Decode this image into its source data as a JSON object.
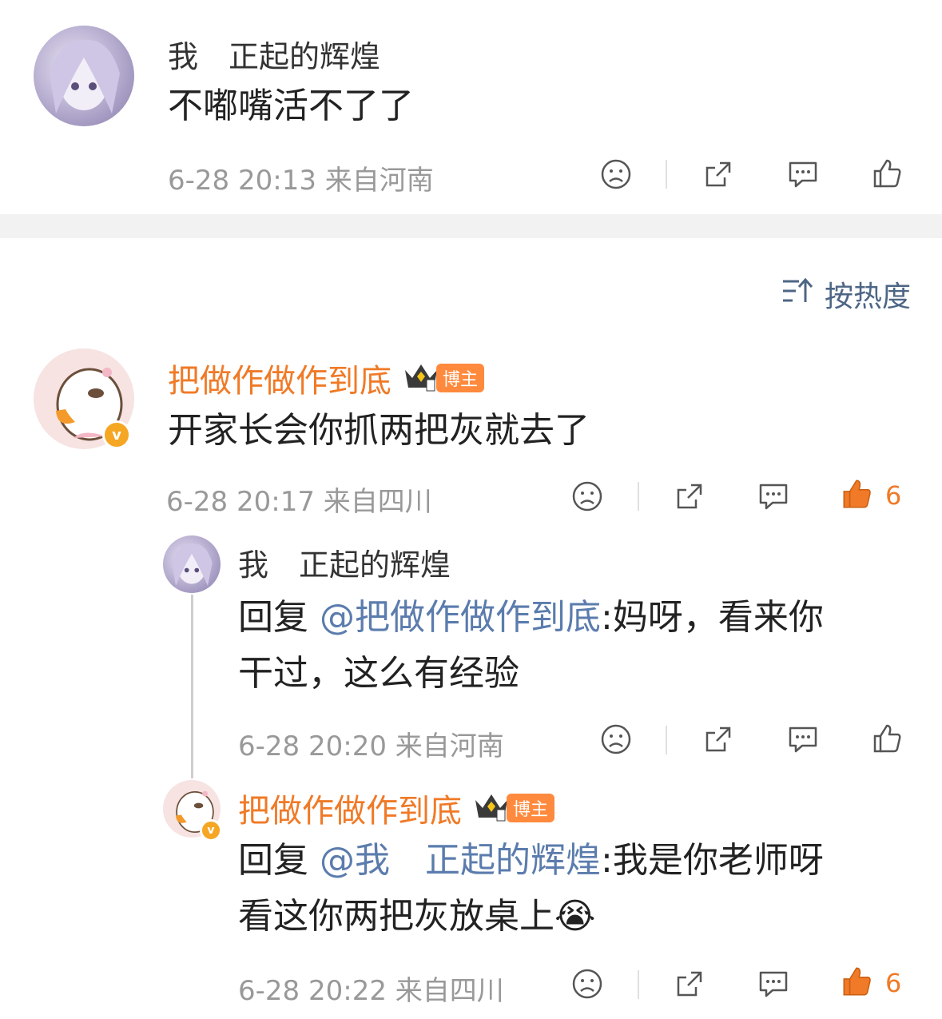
{
  "post": {
    "author": "我　正起的辉煌",
    "text": "不嘟嘴活不了了",
    "meta": "6-28 20:13  来自河南"
  },
  "sort": {
    "label": "按热度"
  },
  "comments": [
    {
      "author": "把做作做作到底",
      "badge": "博主",
      "text": "开家长会你抓两把灰就去了",
      "meta": "6-28 20:17  来自四川",
      "likes": "6"
    }
  ],
  "replies": [
    {
      "author": "我　正起的辉煌",
      "prefix": "回复 ",
      "mention": "@把做作做作到底",
      "line1_rest": ":妈呀，看来你",
      "line2": "干过，这么有经验",
      "meta": "6-28 20:20  来自河南"
    },
    {
      "author": "把做作做作到底",
      "badge": "博主",
      "prefix": "回复 ",
      "mention": "@我　正起的辉煌",
      "line1_rest": ":我是你老师呀",
      "line2": "看这你两把灰放桌上",
      "emoji": "😭",
      "meta": "6-28 20:22  来自四川",
      "likes": "6"
    }
  ],
  "icons": {
    "dislike": "sad-face-icon",
    "share": "share-icon",
    "comment": "comment-icon",
    "like": "thumbs-up-icon"
  },
  "colors": {
    "accent_orange": "#f07a27",
    "mention_blue": "#5b7cad",
    "meta_gray": "#999999",
    "divider": "#f2f2f2"
  }
}
